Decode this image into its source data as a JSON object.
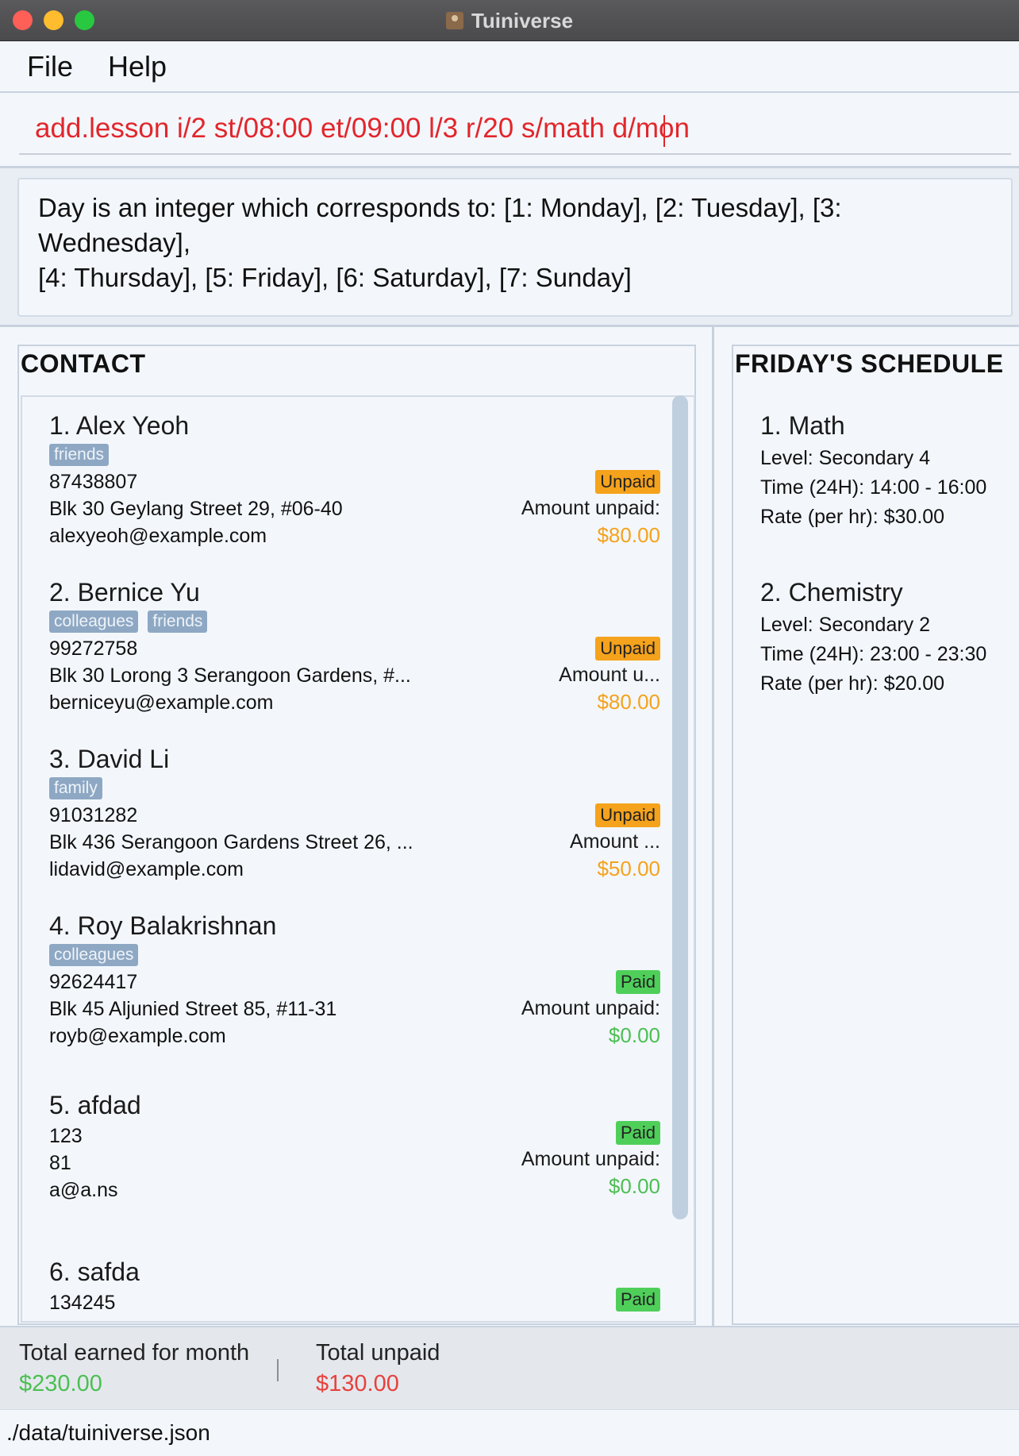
{
  "window": {
    "title": "Tuiniverse"
  },
  "menu": {
    "items": [
      "File",
      "Help"
    ]
  },
  "command": {
    "value": "add.lesson i/2 st/08:00 et/09:00 l/3 r/20 s/math d/mon"
  },
  "result": {
    "line1": "Day is an integer which corresponds to: [1: Monday], [2: Tuesday], [3: Wednesday],",
    "line2": "[4: Thursday], [5: Friday], [6: Saturday], [7: Sunday]"
  },
  "contacts": {
    "title": "CONTACT",
    "items": [
      {
        "name": "1. Alex Yeoh",
        "tags": [
          "friends"
        ],
        "phone": "87438807",
        "address": "Blk 30 Geylang Street 29, #06-40",
        "email": "alexyeoh@example.com",
        "status": "Unpaid",
        "amount_label": "Amount unpaid:",
        "amount": "$80.00"
      },
      {
        "name": "2. Bernice Yu",
        "tags": [
          "colleagues",
          "friends"
        ],
        "phone": "99272758",
        "address": "Blk 30 Lorong 3 Serangoon Gardens, #...",
        "email": "berniceyu@example.com",
        "status": "Unpaid",
        "amount_label": "Amount u...",
        "amount": "$80.00"
      },
      {
        "name": "3. David Li",
        "tags": [
          "family"
        ],
        "phone": "91031282",
        "address": "Blk 436 Serangoon Gardens Street 26, ...",
        "email": "lidavid@example.com",
        "status": "Unpaid",
        "amount_label": "Amount ...",
        "amount": "$50.00"
      },
      {
        "name": "4. Roy Balakrishnan",
        "tags": [
          "colleagues"
        ],
        "phone": "92624417",
        "address": "Blk 45 Aljunied Street 85, #11-31",
        "email": "royb@example.com",
        "status": "Paid",
        "amount_label": "Amount unpaid:",
        "amount": "$0.00"
      },
      {
        "name": "5. afdad",
        "tags": [],
        "phone": "123",
        "address": "81",
        "email": "a@a.ns",
        "status": "Paid",
        "amount_label": "Amount unpaid:",
        "amount": "$0.00"
      },
      {
        "name": "6. safda",
        "tags": [],
        "phone": "134245",
        "status": "Paid"
      }
    ]
  },
  "schedule": {
    "title": "FRIDAY'S SCHEDULE",
    "lessons": [
      {
        "title": "1. Math",
        "level": "Level: Secondary 4",
        "time": "Time (24H): 14:00 - 16:00",
        "rate": "Rate (per hr): $30.00"
      },
      {
        "title": "2. Chemistry",
        "level": "Level: Secondary 2",
        "time": "Time (24H): 23:00 - 23:30",
        "rate": "Rate (per hr): $20.00"
      }
    ]
  },
  "footer": {
    "earned_label": "Total earned for month",
    "earned_value": "$230.00",
    "unpaid_label": "Total unpaid",
    "unpaid_value": "$130.00"
  },
  "status": {
    "path": "./data/tuiniverse.json"
  },
  "colors": {
    "unpaid": "#f5a21c",
    "paid": "#4fcf5a",
    "command_text": "#e2262b",
    "tag": "#8ea8c4"
  }
}
